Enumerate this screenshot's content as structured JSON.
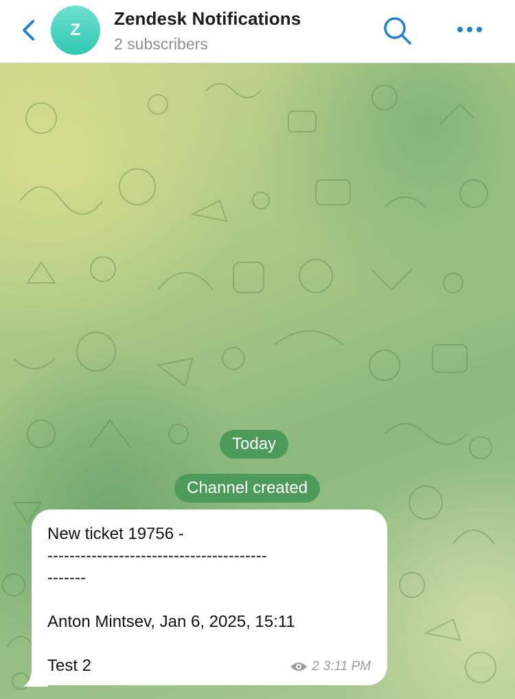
{
  "header": {
    "back_icon": "chevron-left-icon",
    "avatar_letter": "Z",
    "title": "Zendesk Notifications",
    "subtitle": "2 subscribers",
    "search_icon": "search-icon",
    "more_icon": "more-horizontal-icon"
  },
  "chat": {
    "date_pill": "Today",
    "service_message": "Channel created",
    "message": {
      "line1": "New ticket 19756 -",
      "line2": "----------------------------------------",
      "line3": "-------",
      "line4": "Anton Mintsev, Jan 6, 2025, 15:11",
      "line5": "Test 2",
      "views": "2",
      "time": "3:11 PM",
      "views_icon": "eye-icon"
    }
  },
  "colors": {
    "accent": "#2481cc",
    "avatar": "#3fcfb9",
    "pill": "#4e9a5b"
  }
}
